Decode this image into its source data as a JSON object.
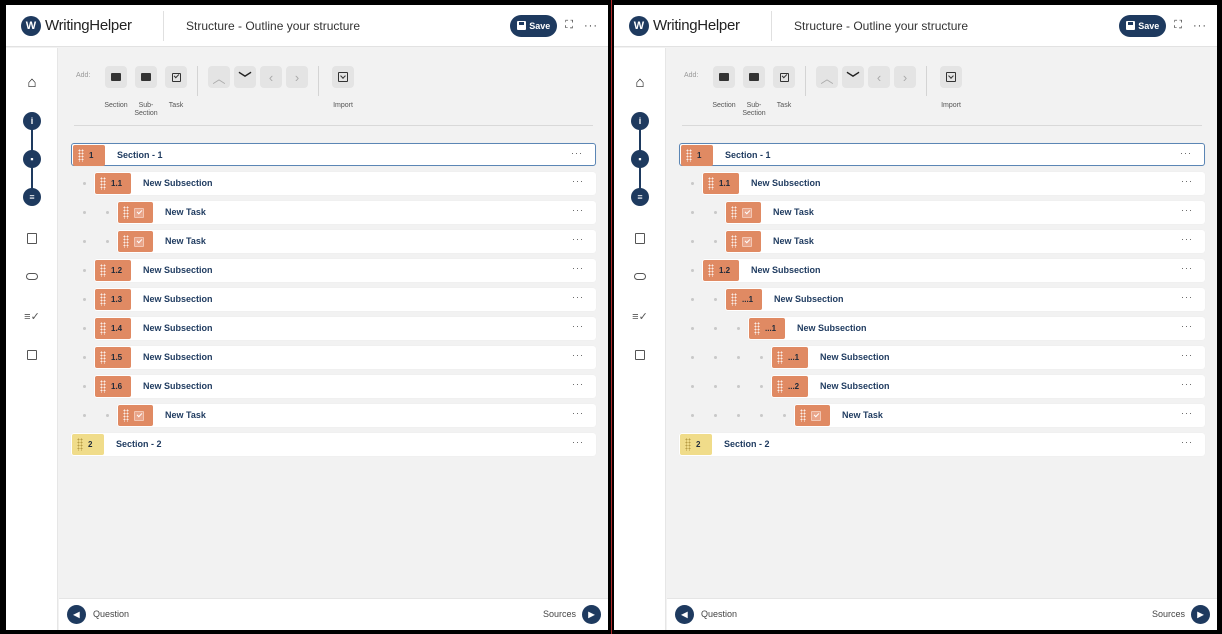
{
  "app": {
    "logo_text": "WritingHelper",
    "logo_mark": "W"
  },
  "header": {
    "title": "Structure - Outline your structure",
    "save_label": "Save",
    "expand_icon": "expand-icon",
    "more_icon": "more-icon"
  },
  "toolbar": {
    "add_label": "Add:",
    "section_label": "Section",
    "subsection_label_1": "Sub-",
    "subsection_label_2": "Section",
    "task_label": "Task",
    "import_label": "Import"
  },
  "footer": {
    "prev_label": "Question",
    "next_label": "Sources"
  },
  "colors": {
    "primary": "#1e3a5f",
    "section_badge": "#e08a63",
    "section2_badge": "#f0dc8a",
    "selected_border": "#5b86b5"
  },
  "left_rows": [
    {
      "kind": "section",
      "num": "1",
      "title": "Section - 1",
      "level": 0,
      "selected": true
    },
    {
      "kind": "subsection",
      "num": "1.1",
      "title": "New Subsection",
      "level": 1
    },
    {
      "kind": "task",
      "num": "",
      "title": "New Task",
      "level": 2
    },
    {
      "kind": "task",
      "num": "",
      "title": "New Task",
      "level": 2
    },
    {
      "kind": "subsection",
      "num": "1.2",
      "title": "New Subsection",
      "level": 1
    },
    {
      "kind": "subsection",
      "num": "1.3",
      "title": "New Subsection",
      "level": 1
    },
    {
      "kind": "subsection",
      "num": "1.4",
      "title": "New Subsection",
      "level": 1
    },
    {
      "kind": "subsection",
      "num": "1.5",
      "title": "New Subsection",
      "level": 1
    },
    {
      "kind": "subsection",
      "num": "1.6",
      "title": "New Subsection",
      "level": 1
    },
    {
      "kind": "task",
      "num": "",
      "title": "New Task",
      "level": 2
    },
    {
      "kind": "section2",
      "num": "2",
      "title": "Section - 2",
      "level": 0
    }
  ],
  "right_rows": [
    {
      "kind": "section",
      "num": "1",
      "title": "Section - 1",
      "level": 0,
      "selected": true
    },
    {
      "kind": "subsection",
      "num": "1.1",
      "title": "New Subsection",
      "level": 1
    },
    {
      "kind": "task",
      "num": "",
      "title": "New Task",
      "level": 2
    },
    {
      "kind": "task",
      "num": "",
      "title": "New Task",
      "level": 2
    },
    {
      "kind": "subsection",
      "num": "1.2",
      "title": "New Subsection",
      "level": 1
    },
    {
      "kind": "subsection",
      "num": "...1",
      "title": "New Subsection",
      "level": 2
    },
    {
      "kind": "subsection",
      "num": "...1",
      "title": "New Subsection",
      "level": 3
    },
    {
      "kind": "subsection",
      "num": "...1",
      "title": "New Subsection",
      "level": 4
    },
    {
      "kind": "subsection",
      "num": "...2",
      "title": "New Subsection",
      "level": 4
    },
    {
      "kind": "task",
      "num": "",
      "title": "New Task",
      "level": 5
    },
    {
      "kind": "section2",
      "num": "2",
      "title": "Section - 2",
      "level": 0
    }
  ]
}
